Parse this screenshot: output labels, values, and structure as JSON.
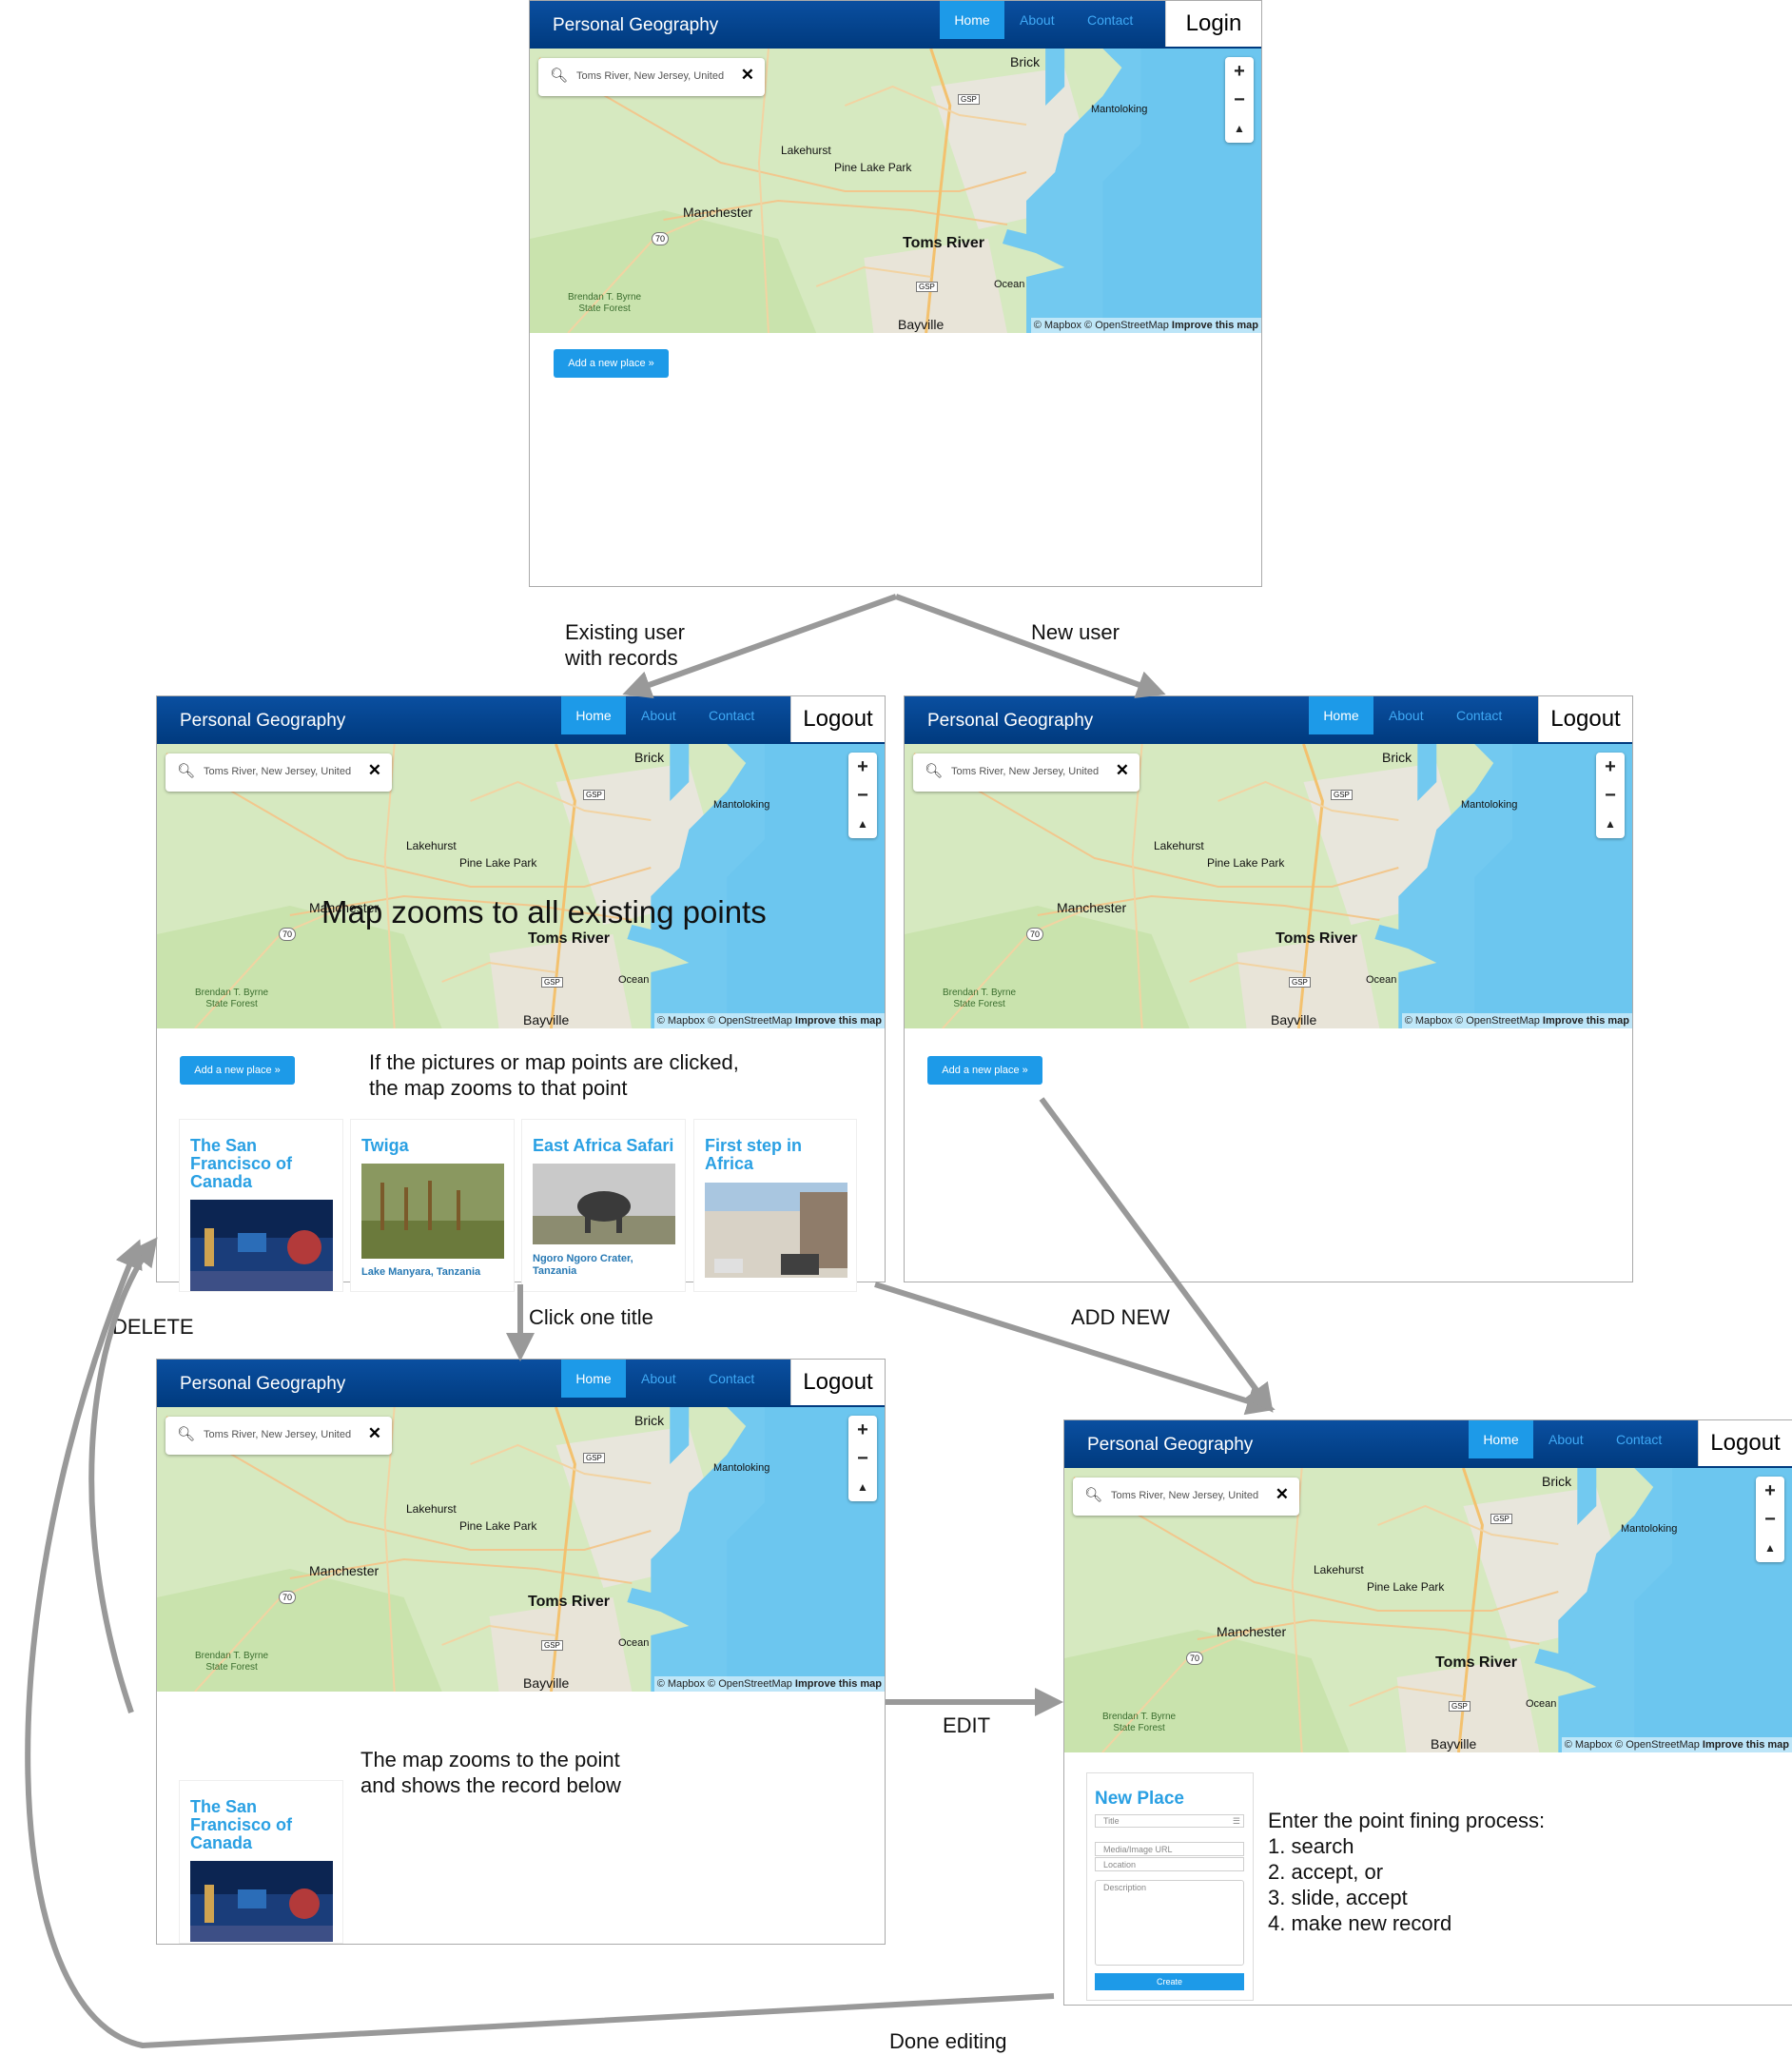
{
  "app": {
    "brand": "Personal Geography",
    "nav": {
      "home": "Home",
      "about": "About",
      "contact": "Contact"
    },
    "login": "Login",
    "logout": "Logout",
    "add_place": "Add a new place »"
  },
  "map": {
    "search_text": "Toms River, New Jersey, United",
    "zoom_in": "+",
    "zoom_out": "−",
    "compass": "▲",
    "attribution": "© Mapbox © OpenStreetMap",
    "improve": "Improve this map",
    "places": {
      "brick": "Brick",
      "mantoloking": "Mantoloking",
      "lakehurst": "Lakehurst",
      "pine_lake_park": "Pine Lake Park",
      "manchester": "Manchester",
      "toms_river": "Toms River",
      "ocean": "Ocean",
      "bayville": "Bayville",
      "forest_line1": "Brendan T. Byrne",
      "forest_line2": "State Forest",
      "route_70": "70",
      "gsp": "GSP"
    }
  },
  "cards": [
    {
      "title": "The San Francisco of Canada",
      "subtitle": ""
    },
    {
      "title": "Twiga",
      "subtitle": "Lake Manyara, Tanzania"
    },
    {
      "title": "East Africa Safari",
      "subtitle": "Ngoro Ngoro Crater, Tanzania"
    },
    {
      "title": "First step in Africa",
      "subtitle": ""
    }
  ],
  "form": {
    "heading": "New Place",
    "title_placeholder": "Title",
    "media_placeholder": "Media/Image URL",
    "location_placeholder": "Location",
    "description_placeholder": "Description",
    "create": "Create"
  },
  "annotations": {
    "existing_user": "Existing user\nwith records",
    "new_user": "New user",
    "map_zooms_all": "Map zooms to all existing points",
    "pictures_clicked": "If the pictures or map points are clicked,\nthe map zooms to that point",
    "click_one_title": "Click one title",
    "add_new": "ADD NEW",
    "delete": "DELETE",
    "edit": "EDIT",
    "map_zooms_point": "The map zooms to the point\nand shows the record below",
    "enter_process": "Enter the point fining process:\n1. search\n2. accept, or\n3. slide, accept\n4. make new record",
    "done_editing": "Done editing"
  }
}
